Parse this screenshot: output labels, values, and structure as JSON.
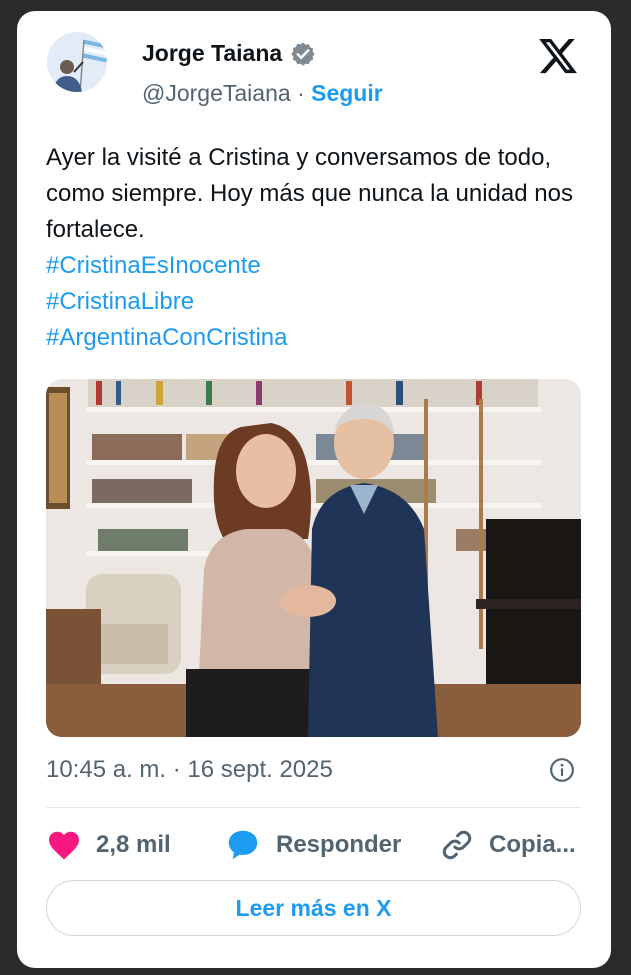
{
  "author": {
    "name": "Jorge Taiana",
    "handle": "@JorgeTaiana",
    "separator": "·",
    "follow_label": "Seguir"
  },
  "tweet": {
    "text": "Ayer la visité a Cristina y conversamos de todo, como siempre. Hoy más que nunca la unidad nos fortalece.",
    "hashtags": [
      "#CristinaEsInocente",
      "#CristinaLibre",
      "#ArgentinaConCristina"
    ],
    "timestamp": "10:45 a. m. · 16 sept. 2025"
  },
  "actions": {
    "likes": "2,8 mil",
    "reply_label": "Responder",
    "copy_label": "Copia..."
  },
  "read_more_label": "Leer más en X",
  "colors": {
    "accent": "#1d9bf0",
    "like": "#f91880",
    "text": "#0f1419",
    "muted": "#536471"
  },
  "icons": {
    "verified": "verified-badge-icon",
    "logo": "x-logo-icon",
    "info": "info-icon",
    "like": "heart-icon",
    "reply": "speech-bubble-icon",
    "copy": "link-icon"
  }
}
